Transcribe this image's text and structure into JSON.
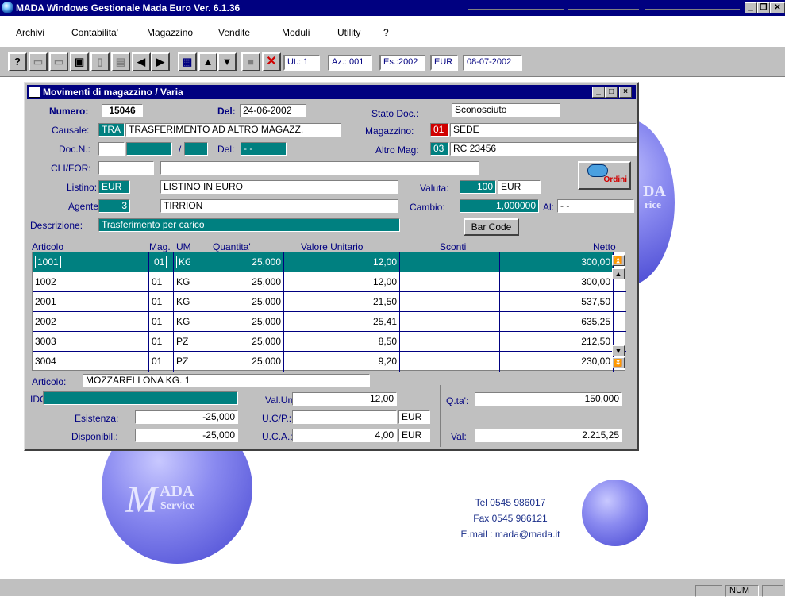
{
  "app": {
    "title": "MADA Windows Gestionale  Mada Euro Ver. 6.1.36",
    "window_buttons": [
      "_",
      "❐",
      "✕"
    ]
  },
  "menu": [
    {
      "first": "A",
      "rest": "rchivi"
    },
    {
      "first": "C",
      "rest": "ontabilita'"
    },
    {
      "first": "M",
      "rest": "agazzino"
    },
    {
      "first": "V",
      "rest": "endite"
    },
    {
      "first": "M",
      "rest": "oduli"
    },
    {
      "first": "U",
      "rest": "tility"
    },
    {
      "first": "?",
      "rest": ""
    }
  ],
  "toolbar": {
    "icons": [
      "help-icon",
      "blank-icon",
      "blank-icon",
      "save-icon",
      "blank-icon",
      "edit-icon",
      "prev-icon",
      "next-icon",
      "report-icon",
      "up-icon",
      "down-icon",
      "blank-icon",
      "delete-icon"
    ],
    "ut": "Ut.: 1",
    "az": "Az.: 001",
    "es": "Es.:2002",
    "currency": "EUR",
    "date": "08-07-2002"
  },
  "window": {
    "title": "Movimenti di magazzino / Varia",
    "numero_label": "Numero:",
    "numero": "15046",
    "del_label": "Del:",
    "del_value": "24-06-2002",
    "stato_label": "Stato Doc.:",
    "stato_value": "Sconosciuto",
    "causale_label": "Causale:",
    "causale_code": "TRA",
    "causale_desc": "TRASFERIMENTO AD ALTRO MAGAZZ.",
    "magazzino_label": "Magazzino:",
    "magazzino_code": "01",
    "magazzino_desc": "SEDE",
    "docn_label": "Doc.N.:",
    "docn_sep": "/",
    "docdel_label": "Del:",
    "docdel_value": "- -",
    "altromag_label": "Altro Mag:",
    "altromag_code": "03",
    "altromag_desc": "RC 23456",
    "clifor_label": "CLI/FOR:",
    "listino_label": "Listino:",
    "listino_code": "EUR",
    "listino_desc": "LISTINO IN EURO",
    "valuta_label": "Valuta:",
    "valuta_code": "100",
    "valuta_desc": "EUR",
    "ordini_label": "Ordini",
    "agente_label": "Agente:",
    "agente_code": "3",
    "agente_desc": "TIRRION",
    "cambio_label": "Cambio:",
    "cambio_value": "1,000000",
    "al_label": "Al:",
    "al_value": "- -",
    "descrizione_label": "Descrizione:",
    "descrizione_value": "Trasferimento per carico",
    "barcode_label": "Bar Code"
  },
  "table": {
    "headers": [
      "Articolo",
      "Mag.",
      "UM",
      "Quantita'",
      "Valore Unitario",
      "Sconti",
      "Netto"
    ],
    "rows": [
      {
        "articolo": "1001",
        "mag": "01",
        "um": "KG",
        "qta": "25,000",
        "valore": "12,00",
        "netto": "300,00"
      },
      {
        "articolo": "1002",
        "mag": "01",
        "um": "KG",
        "qta": "25,000",
        "valore": "12,00",
        "netto": "300,00"
      },
      {
        "articolo": "2001",
        "mag": "01",
        "um": "KG",
        "qta": "25,000",
        "valore": "21,50",
        "netto": "537,50"
      },
      {
        "articolo": "2002",
        "mag": "01",
        "um": "KG",
        "qta": "25,000",
        "valore": "25,41",
        "netto": "635,25"
      },
      {
        "articolo": "3003",
        "mag": "01",
        "um": "PZ",
        "qta": "25,000",
        "valore": "8,50",
        "netto": "212,50"
      },
      {
        "articolo": "3004",
        "mag": "01",
        "um": "PZ",
        "qta": "25,000",
        "valore": "9,20",
        "netto": "230,00"
      }
    ]
  },
  "footer": {
    "articolo_label": "Articolo:",
    "articolo_value": "MOZZARELLONA KG. 1",
    "idc_label": "IDC",
    "valuni_label": "Val.Uni:",
    "valuni_value": "12,00",
    "qta_label": "Q.ta':",
    "qta_value": "150,000",
    "esistenza_label": "Esistenza:",
    "esistenza_value": "-25,000",
    "ucp_label": "U.C/P.:",
    "ucp_currency": "EUR",
    "disponibil_label": "Disponibil.:",
    "disponibil_value": "-25,000",
    "uca_label": "U.C.A.:",
    "uca_value": "4,00",
    "uca_currency": "EUR",
    "val_label": "Val:",
    "val_value": "2.215,25"
  },
  "background": {
    "logo_top": "ADA",
    "logo_sub": "Service",
    "logo_m": "M",
    "right_logo_top": "DA",
    "right_logo_sub": "rice",
    "tel": "Tel 0545 986017",
    "fax": "Fax 0545 986121",
    "email": "E.mail : mada@mada.it"
  },
  "status": {
    "num": "NUM"
  }
}
